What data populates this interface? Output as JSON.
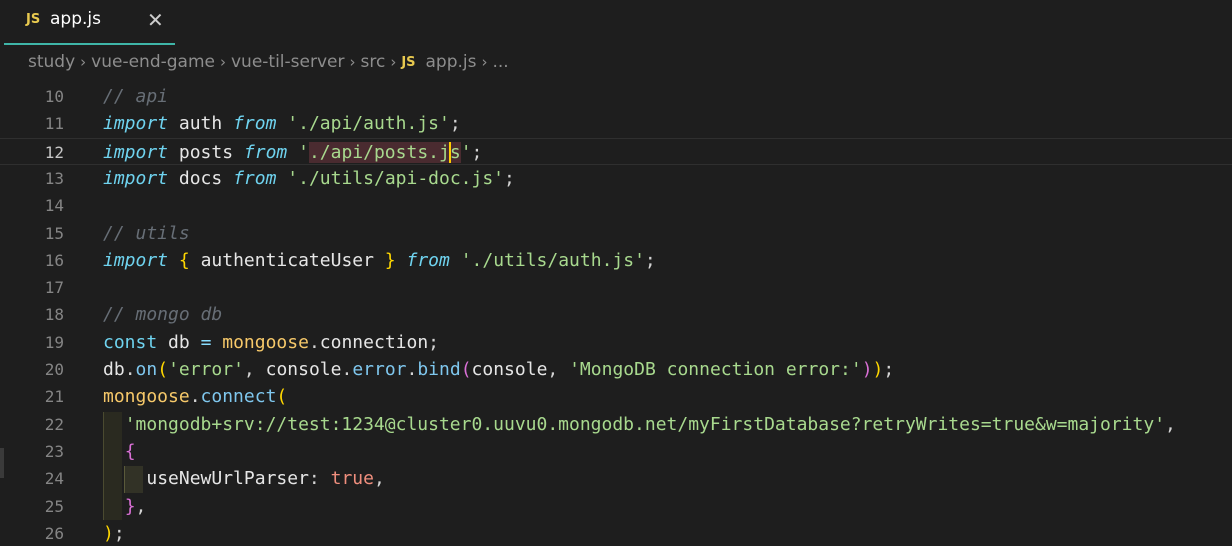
{
  "tab": {
    "badge": "JS",
    "label": "app.js",
    "close": "✕"
  },
  "breadcrumb": {
    "items": [
      "study",
      "vue-end-game",
      "vue-til-server",
      "src"
    ],
    "file_badge": "JS",
    "file": "app.js",
    "more": "..."
  },
  "lines": [
    {
      "n": "10",
      "html": "<span class=\"cmt\">// api</span>"
    },
    {
      "n": "11",
      "html": "<span class=\"kw\">import</span> <span class=\"id\">auth</span> <span class=\"kw-from\">from</span> <span class=\"str\">'./api/auth.js'</span>;"
    },
    {
      "n": "12",
      "current": true,
      "html": "<span class=\"kw\">import</span> <span class=\"id\">posts</span> <span class=\"kw-from\">from</span> <span class=\"str\">'<span class=\"hl\">./api/posts.j<span class=\"cursor\"></span>s</span>'</span>;"
    },
    {
      "n": "13",
      "html": "<span class=\"kw\">import</span> <span class=\"id\">docs</span> <span class=\"kw-from\">from</span> <span class=\"str\">'./utils/api-doc.js'</span>;"
    },
    {
      "n": "14",
      "html": ""
    },
    {
      "n": "15",
      "html": "<span class=\"cmt\">// utils</span>"
    },
    {
      "n": "16",
      "html": "<span class=\"kw\">import</span> <span class=\"b1\">{</span> <span class=\"id\">authenticateUser</span> <span class=\"b1\">}</span> <span class=\"kw-from\">from</span> <span class=\"str\">'./utils/auth.js'</span>;"
    },
    {
      "n": "17",
      "html": ""
    },
    {
      "n": "18",
      "html": "<span class=\"cmt\">// mongo db</span>"
    },
    {
      "n": "19",
      "html": "<span class=\"kw-plain\">const</span> <span class=\"id\">db</span> <span class=\"op\">=</span> <span class=\"var\">mongoose</span>.<span class=\"id\">connection</span>;"
    },
    {
      "n": "20",
      "html": "<span class=\"id\">db</span>.<span class=\"fn\">on</span><span class=\"b1\">(</span><span class=\"str\">'error'</span>, <span class=\"id\">console</span>.<span class=\"fn\">error</span>.<span class=\"fn\">bind</span><span class=\"b2\">(</span><span class=\"id\">console</span>, <span class=\"str\">'MongoDB connection error:'</span><span class=\"b2\">)</span><span class=\"b1\">)</span>;"
    },
    {
      "n": "21",
      "html": "<span class=\"var\">mongoose</span>.<span class=\"fn\">connect</span><span class=\"b1\">(</span>"
    },
    {
      "n": "22",
      "html": "  <span class=\"str\">'mongodb+srv://test:1234@cluster0.uuvu0.mongodb.net/myFirstDatabase?retryWrites=true&amp;w=majority'</span>,"
    },
    {
      "n": "23",
      "html": "  <span class=\"b2\">{</span>"
    },
    {
      "n": "24",
      "html": "    <span class=\"id\">useNewUrlParser</span>: <span class=\"bool\">true</span>,"
    },
    {
      "n": "25",
      "html": "  <span class=\"b2\">}</span>,"
    },
    {
      "n": "26",
      "html": "<span class=\"b1\">)</span>;"
    }
  ],
  "colors": {
    "background": "#1e1e1e",
    "tab_underline": "#3fb5a8",
    "js_badge": "#e8c94f"
  }
}
